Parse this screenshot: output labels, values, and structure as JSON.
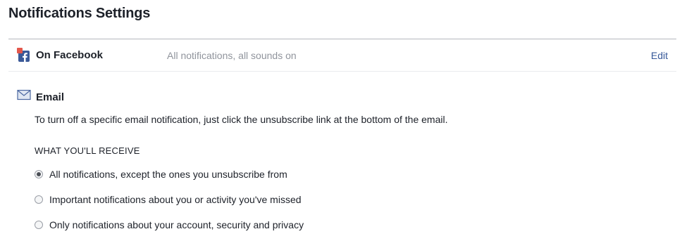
{
  "page": {
    "title": "Notifications Settings"
  },
  "on_facebook": {
    "icon": "facebook-notification-icon",
    "label": "On Facebook",
    "summary": "All notifications, all sounds on",
    "edit_label": "Edit"
  },
  "email": {
    "icon": "envelope-icon",
    "label": "Email",
    "description": "To turn off a specific email notification, just click the unsubscribe link at the bottom of the email.",
    "receive_heading": "WHAT YOU'LL RECEIVE",
    "options": [
      {
        "label": "All notifications, except the ones you unsubscribe from",
        "checked": true
      },
      {
        "label": "Important notifications about you or activity you've missed",
        "checked": false
      },
      {
        "label": "Only notifications about your account, security and privacy",
        "checked": false
      }
    ]
  },
  "colors": {
    "link": "#365899",
    "muted_text": "#90949c",
    "facebook_blue": "#3b5998",
    "notification_red": "#e4574b"
  }
}
